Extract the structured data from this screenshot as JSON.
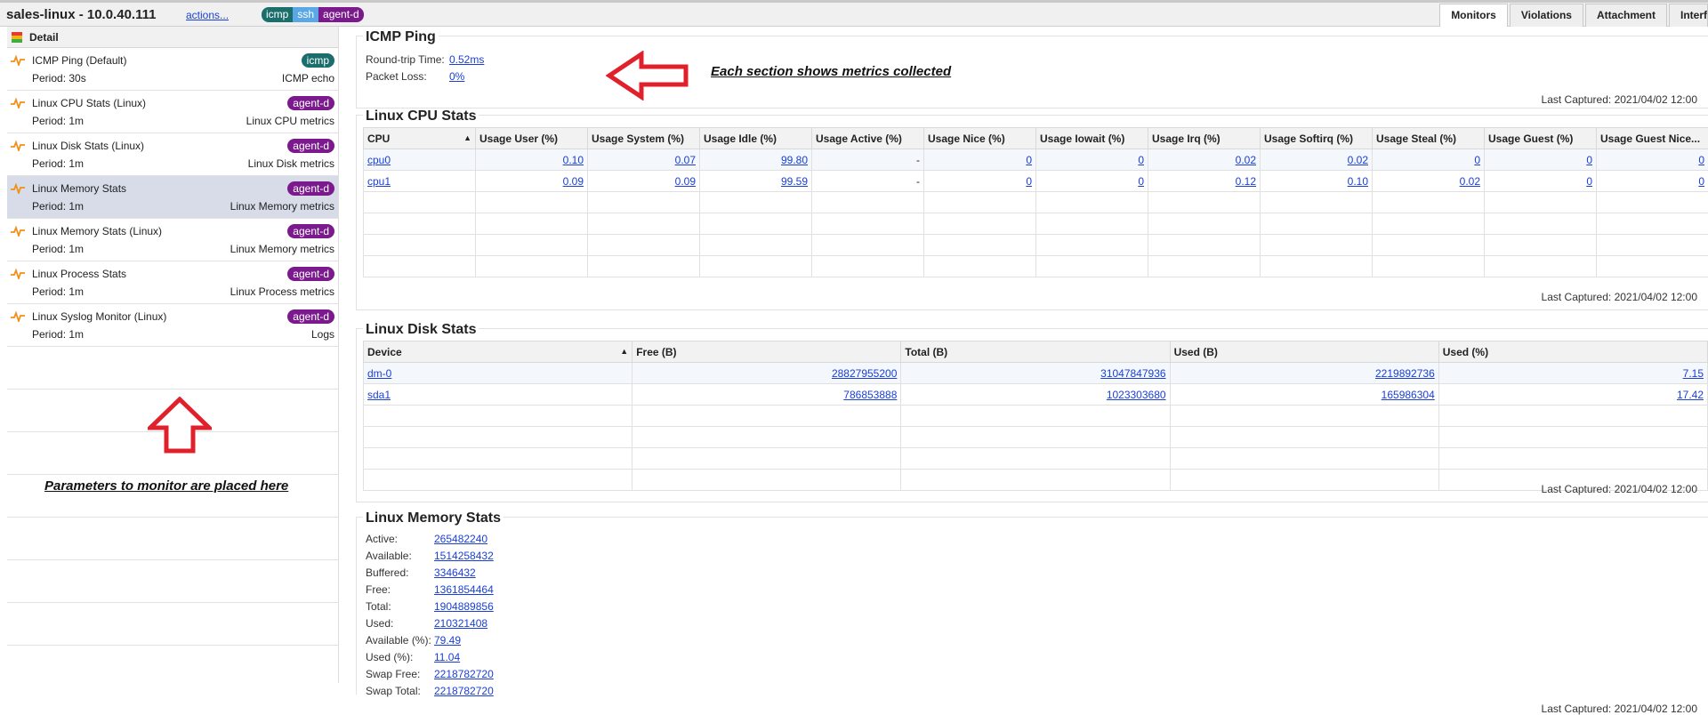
{
  "header": {
    "host": "sales-linux - 10.0.40.111",
    "actions": "actions...",
    "tags": [
      "icmp",
      "ssh",
      "agent-d"
    ],
    "tabs": [
      "Monitors",
      "Violations",
      "Attachment",
      "Interfaces"
    ],
    "active_tab": "Monitors"
  },
  "sidebar": {
    "header": "Detail",
    "annotation": "Parameters to monitor are placed here",
    "monitors": [
      {
        "name": "ICMP Ping (Default)",
        "badge": "icmp",
        "period": "Period: 30s",
        "desc": "ICMP echo"
      },
      {
        "name": "Linux CPU Stats (Linux)",
        "badge": "agent-d",
        "period": "Period: 1m",
        "desc": "Linux CPU metrics"
      },
      {
        "name": "Linux Disk Stats (Linux)",
        "badge": "agent-d",
        "period": "Period: 1m",
        "desc": "Linux Disk metrics"
      },
      {
        "name": "Linux Memory Stats",
        "badge": "agent-d",
        "period": "Period: 1m",
        "desc": "Linux Memory metrics",
        "selected": true
      },
      {
        "name": "Linux Memory Stats (Linux)",
        "badge": "agent-d",
        "period": "Period: 1m",
        "desc": "Linux Memory metrics"
      },
      {
        "name": "Linux Process Stats",
        "badge": "agent-d",
        "period": "Period: 1m",
        "desc": "Linux Process metrics"
      },
      {
        "name": "Linux Syslog Monitor (Linux)",
        "badge": "agent-d",
        "period": "Period: 1m",
        "desc": "Logs"
      }
    ]
  },
  "annotation_main": "Each section shows metrics collected",
  "icmp": {
    "title": "ICMP Ping",
    "rtt_label": "Round-trip Time:",
    "rtt_value": "0.52ms",
    "loss_label": "Packet Loss:",
    "loss_value": "0%",
    "captured": "Last Captured: 2021/04/02 12:00"
  },
  "cpu": {
    "title": "Linux CPU Stats",
    "columns": [
      "CPU",
      "Usage User (%)",
      "Usage System (%)",
      "Usage Idle (%)",
      "Usage Active (%)",
      "Usage Nice (%)",
      "Usage Iowait (%)",
      "Usage Irq (%)",
      "Usage Softirq (%)",
      "Usage Steal (%)",
      "Usage Guest (%)",
      "Usage Guest Nice..."
    ],
    "rows": [
      [
        "cpu0",
        "0.10",
        "0.07",
        "99.80",
        "-",
        "0",
        "0",
        "0.02",
        "0.02",
        "0",
        "0",
        "0"
      ],
      [
        "cpu1",
        "0.09",
        "0.09",
        "99.59",
        "-",
        "0",
        "0",
        "0.12",
        "0.10",
        "0.02",
        "0",
        "0"
      ]
    ],
    "captured": "Last Captured: 2021/04/02 12:00"
  },
  "disk": {
    "title": "Linux Disk Stats",
    "columns": [
      "Device",
      "Free (B)",
      "Total (B)",
      "Used (B)",
      "Used (%)"
    ],
    "rows": [
      [
        "dm-0",
        "28827955200",
        "31047847936",
        "2219892736",
        "7.15"
      ],
      [
        "sda1",
        "786853888",
        "1023303680",
        "165986304",
        "17.42"
      ]
    ],
    "captured": "Last Captured: 2021/04/02 12:00"
  },
  "memory": {
    "title": "Linux Memory Stats",
    "items": [
      {
        "k": "Active:",
        "v": "265482240"
      },
      {
        "k": "Available:",
        "v": "1514258432"
      },
      {
        "k": "Buffered:",
        "v": "3346432"
      },
      {
        "k": "Free:",
        "v": "1361854464"
      },
      {
        "k": "Total:",
        "v": "1904889856"
      },
      {
        "k": "Used:",
        "v": "210321408"
      },
      {
        "k": "Available (%):",
        "v": "79.49"
      },
      {
        "k": "Used (%):",
        "v": "11.04"
      },
      {
        "k": "Swap Free:",
        "v": "2218782720"
      },
      {
        "k": "Swap Total:",
        "v": "2218782720"
      }
    ],
    "captured": "Last Captured: 2021/04/02 12:00"
  },
  "colors": {
    "icmp_badge": "#1a6f6c",
    "agent_badge": "#7b1a8c",
    "ssh_badge": "#5aa7e6",
    "annotation_red": "#e0202a",
    "link": "#1a3fd6"
  }
}
